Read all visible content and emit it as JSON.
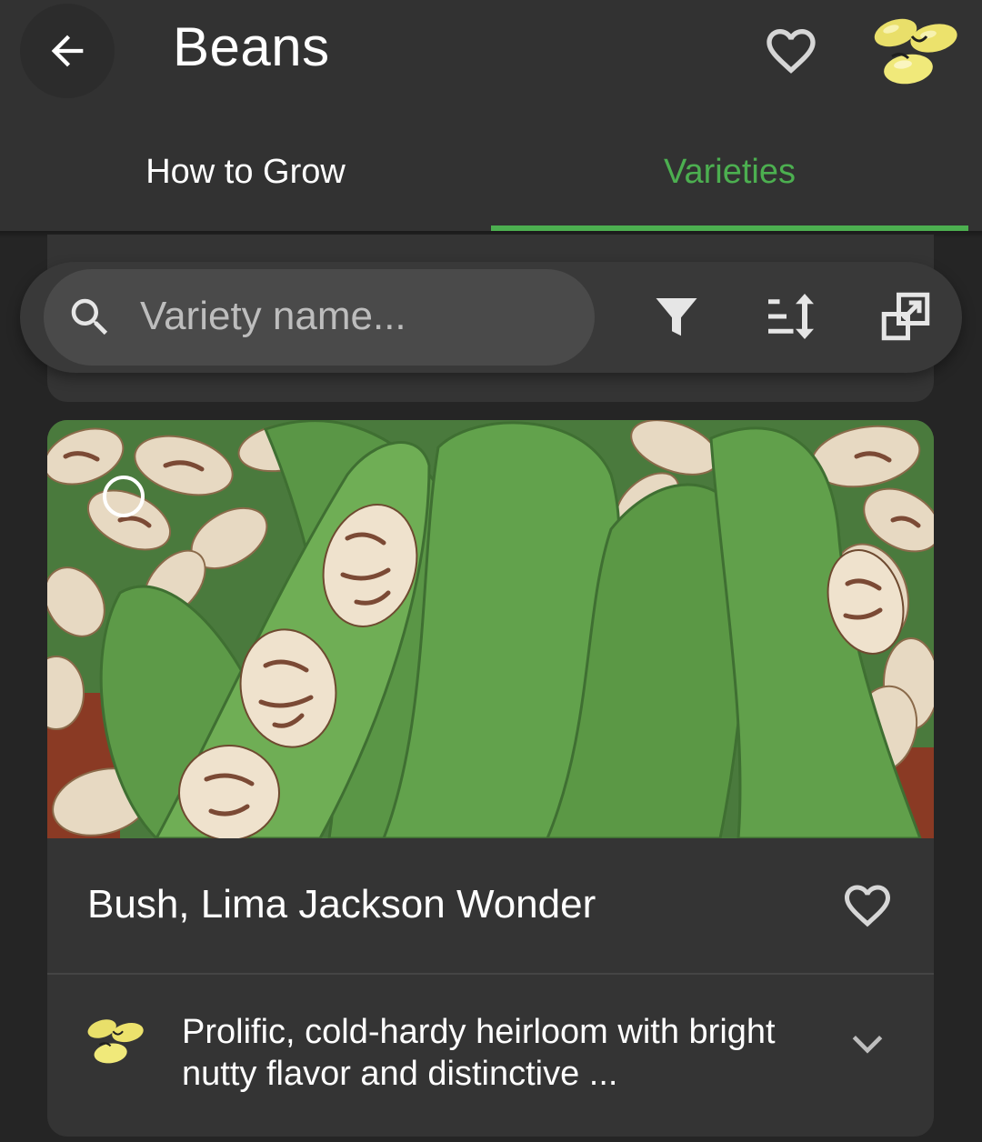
{
  "header": {
    "title": "Beans",
    "tabs": [
      {
        "label": "How to Grow",
        "active": false
      },
      {
        "label": "Varieties",
        "active": true
      }
    ]
  },
  "search": {
    "placeholder": "Variety name...",
    "value": ""
  },
  "card": {
    "title": "Bush, Lima Jackson Wonder",
    "description": "Prolific, cold-hardy heirloom with bright nutty flavor and distinctive ...",
    "selected": false,
    "favorite": false
  },
  "icons": {
    "back": "arrow-left-icon",
    "favorite": "heart-outline-icon",
    "logo": "bean-icon",
    "search": "search-icon",
    "filter": "filter-icon",
    "sort": "sort-icon",
    "compare": "compare-icon",
    "expand": "chevron-down-icon"
  },
  "colors": {
    "accent": "#4caf50",
    "header_bg": "#323232",
    "page_bg": "#252525",
    "card_bg": "#343434",
    "bean_yellow": "#e9df6a"
  }
}
